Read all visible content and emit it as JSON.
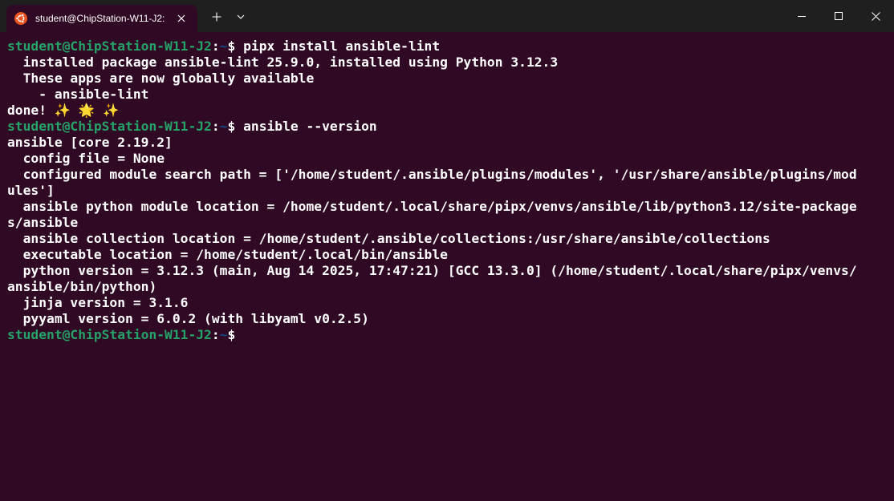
{
  "window": {
    "tab_title": "student@ChipStation-W11-J2:",
    "icons": {
      "tab": "ubuntu-icon",
      "close_tab": "close-icon",
      "new_tab": "plus-icon",
      "dropdown": "chevron-down-icon",
      "minimize": "minimize-icon",
      "maximize": "maximize-icon",
      "close": "close-icon"
    },
    "colors": {
      "titlebar": "#1f1f1f",
      "terminal_bg": "#300a24",
      "prompt_user": "#26a269",
      "prompt_path": "#12488b",
      "ubuntu_orange": "#e95420"
    }
  },
  "terminal": {
    "prompt": {
      "user_host": "student@ChipStation-W11-J2",
      "colon": ":",
      "path": "~",
      "dollar": "$"
    },
    "lines": [
      {
        "type": "prompt",
        "command": " pipx install ansible-lint"
      },
      {
        "type": "output",
        "text": "  installed package ansible-lint 25.9.0, installed using Python 3.12.3"
      },
      {
        "type": "output",
        "text": "  These apps are now globally available"
      },
      {
        "type": "output",
        "text": "    - ansible-lint"
      },
      {
        "type": "output",
        "text": "done! ✨ 🌟 ✨"
      },
      {
        "type": "prompt",
        "command": " ansible --version"
      },
      {
        "type": "output",
        "text": "ansible [core 2.19.2]"
      },
      {
        "type": "output",
        "text": "  config file = None"
      },
      {
        "type": "output",
        "text": "  configured module search path = ['/home/student/.ansible/plugins/modules', '/usr/share/ansible/plugins/mod"
      },
      {
        "type": "output",
        "text": "ules']"
      },
      {
        "type": "output",
        "text": "  ansible python module location = /home/student/.local/share/pipx/venvs/ansible/lib/python3.12/site-package"
      },
      {
        "type": "output",
        "text": "s/ansible"
      },
      {
        "type": "output",
        "text": "  ansible collection location = /home/student/.ansible/collections:/usr/share/ansible/collections"
      },
      {
        "type": "output",
        "text": "  executable location = /home/student/.local/bin/ansible"
      },
      {
        "type": "output",
        "text": "  python version = 3.12.3 (main, Aug 14 2025, 17:47:21) [GCC 13.3.0] (/home/student/.local/share/pipx/venvs/"
      },
      {
        "type": "output",
        "text": "ansible/bin/python)"
      },
      {
        "type": "output",
        "text": "  jinja version = 3.1.6"
      },
      {
        "type": "output",
        "text": "  pyyaml version = 6.0.2 (with libyaml v0.2.5)"
      },
      {
        "type": "prompt",
        "command": ""
      }
    ]
  }
}
